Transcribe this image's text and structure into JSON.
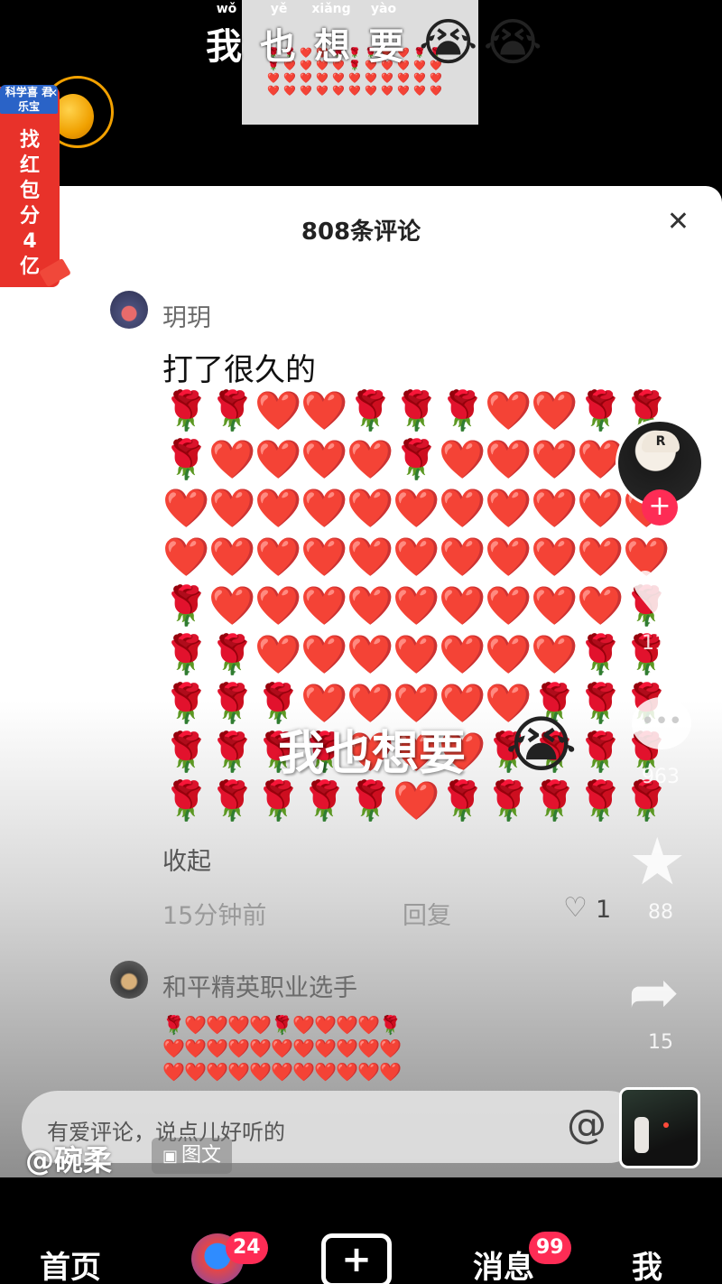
{
  "video_top": {
    "pinyin": [
      "wǒ",
      "yě",
      "xiǎng",
      "yào"
    ],
    "title_chars": [
      "我",
      "也",
      "想",
      "要"
    ],
    "emoji": "😭",
    "thumb_emoji": "🌹❤️"
  },
  "promo": {
    "brand": "科学喜 君乐宝",
    "close": "✕",
    "text": "找红包分4亿"
  },
  "sheet": {
    "title": "808条评论",
    "close": "✕"
  },
  "comments": [
    {
      "user": "玥玥",
      "text": "打了很久的",
      "collapse": "收起",
      "time": "15分钟前",
      "reply": "回复",
      "likes": "1",
      "emoji_grid": [
        "🌹",
        "🌹",
        "❤️",
        "❤️",
        "🌹",
        "🌹",
        "🌹",
        "❤️",
        "❤️",
        "🌹",
        "🌹",
        "🌹",
        "❤️",
        "❤️",
        "❤️",
        "❤️",
        "🌹",
        "❤️",
        "❤️",
        "❤️",
        "❤️",
        "❤️",
        "❤️",
        "❤️",
        "❤️",
        "❤️",
        "❤️",
        "❤️",
        "❤️",
        "❤️",
        "❤️",
        "❤️",
        "❤️",
        "❤️",
        "❤️",
        "❤️",
        "❤️",
        "❤️",
        "❤️",
        "❤️",
        "❤️",
        "❤️",
        "❤️",
        "❤️",
        "🌹",
        "❤️",
        "❤️",
        "❤️",
        "❤️",
        "❤️",
        "❤️",
        "❤️",
        "❤️",
        "❤️",
        "🌹",
        "🌹",
        "🌹",
        "❤️",
        "❤️",
        "❤️",
        "❤️",
        "❤️",
        "❤️",
        "❤️",
        "🌹",
        "🌹",
        "🌹",
        "🌹",
        "🌹",
        "❤️",
        "❤️",
        "❤️",
        "❤️",
        "❤️",
        "🌹",
        "🌹",
        "🌹",
        "🌹",
        "🌹",
        "🌹",
        "🌹",
        "❤️",
        "❤️",
        "❤️",
        "🌹",
        "🌹",
        "🌹",
        "🌹",
        "🌹",
        "🌹",
        "🌹",
        "🌹",
        "🌹",
        "❤️",
        "🌹",
        "🌹",
        "🌹",
        "🌹",
        "🌹"
      ]
    },
    {
      "user": "和平精英职业选手",
      "emoji_grid": [
        "🌹",
        "❤️",
        "❤️",
        "❤️",
        "❤️",
        "🌹",
        "❤️",
        "❤️",
        "❤️",
        "❤️",
        "🌹",
        "❤️",
        "❤️",
        "❤️",
        "❤️",
        "❤️",
        "❤️",
        "❤️",
        "❤️",
        "❤️",
        "❤️",
        "❤️",
        "❤️",
        "❤️",
        "❤️",
        "❤️",
        "❤️",
        "❤️",
        "❤️",
        "❤️",
        "❤️",
        "❤️",
        "❤️"
      ]
    }
  ],
  "overlay_caption": {
    "text": "我也想要",
    "emoji": "😭"
  },
  "rail": {
    "follow": "+",
    "like_count": "112",
    "comment_count": "963",
    "favorite_count": "88",
    "share_count": "15"
  },
  "input": {
    "placeholder": "有爱评论，说点儿好听的",
    "at": "@"
  },
  "author": {
    "name": "@碗柔",
    "tag": "图文"
  },
  "nav": {
    "home": "首页",
    "friends_badge": "24",
    "plus": "+",
    "messages": "消息",
    "messages_badge": "99",
    "me": "我"
  },
  "colors": {
    "accent": "#fe2c55",
    "promo_red": "#e8322a",
    "promo_blue": "#2a63c7"
  }
}
